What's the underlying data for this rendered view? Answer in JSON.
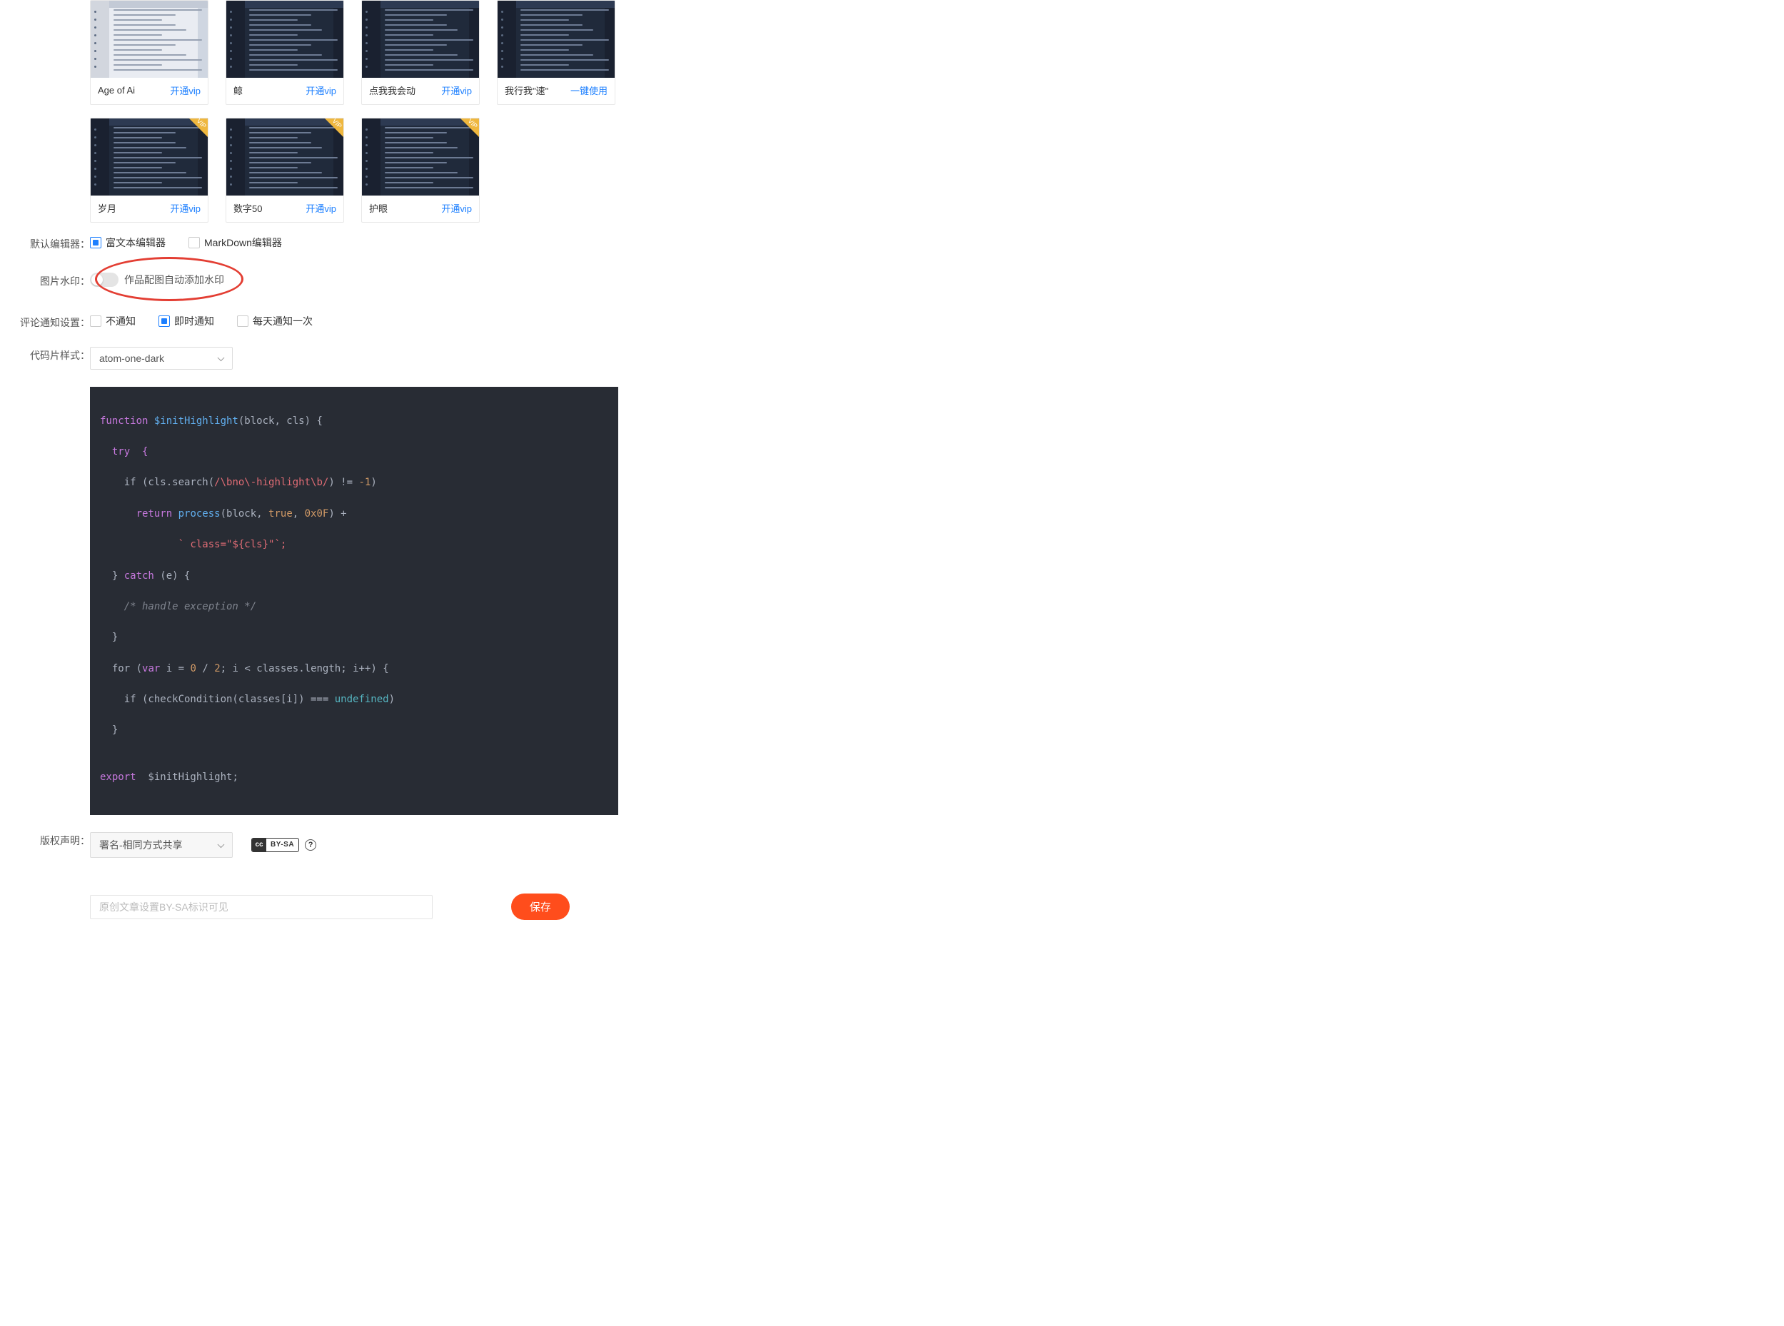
{
  "badges": {
    "vip": "VIP"
  },
  "themes_row1": [
    {
      "title": "Age of Ai",
      "action": "开通vip",
      "light": true,
      "vip": false
    },
    {
      "title": "鲸",
      "action": "开通vip",
      "light": false,
      "vip": false
    },
    {
      "title": "点我我会动",
      "action": "开通vip",
      "light": false,
      "vip": false
    },
    {
      "title": "我行我\"速\"",
      "action": "一键使用",
      "light": false,
      "vip": false
    }
  ],
  "themes_row2": [
    {
      "title": "岁月",
      "action": "开通vip",
      "light": false,
      "vip": true
    },
    {
      "title": "数字50",
      "action": "开通vip",
      "light": false,
      "vip": true
    },
    {
      "title": "护眼",
      "action": "开通vip",
      "light": false,
      "vip": true
    }
  ],
  "default_editor": {
    "label": "默认编辑器：",
    "opt1": "富文本编辑器",
    "opt2": "MarkDown编辑器",
    "selected": 0
  },
  "watermark": {
    "label": "图片水印：",
    "hint": "作品配图自动添加水印",
    "on": false
  },
  "comment_notify": {
    "label": "评论通知设置：",
    "opt1": "不通知",
    "opt2": "即时通知",
    "opt3": "每天通知一次",
    "selected": 1
  },
  "code_style": {
    "label": "代码片样式：",
    "value": "atom-one-dark"
  },
  "code_sample": {
    "fn_kw": "function ",
    "fn_name": "$initHighlight",
    "fn_args": "(block, cls) {",
    "try": "  try  {",
    "if1_a": "    if (cls.search(",
    "if1_re": "/\\bno\\-highlight\\b/",
    "if1_b": ") != ",
    "if1_neg1": "-1",
    "if1_c": ")",
    "ret_a": "      return",
    "ret_fn": " process",
    "ret_args_a": "(block, ",
    "ret_true": "true",
    "ret_args_b": ", ",
    "ret_hex": "0x0F",
    "ret_args_c": ") +",
    "tpl_a": "             ` class=\"",
    "tpl_sub": "${cls}",
    "tpl_b": "\"`;",
    "close_try": "  } ",
    "catch_kw": "catch",
    "catch_args": " (e) {",
    "cmt": "    /* handle exception */",
    "close_catch": "  }",
    "for_a": "  for (",
    "for_var": "var",
    "for_b": " i = ",
    "for_0": "0",
    "for_div": " / ",
    "for_2": "2",
    "for_c": "; i < classes.length; i++) {",
    "if2_a": "    if (checkCondition(classes[i]) === ",
    "if2_undef": "undefined",
    "if2_b": ")",
    "close_for": "  }",
    "blank": "",
    "export_kw": "export",
    "export_b": "  $initHighlight;"
  },
  "license": {
    "label": "版权声明：",
    "value": "署名-相同方式共享",
    "cc_left": "cc",
    "cc_right": "BY-SA",
    "help": "?",
    "placeholder": "原创文章设置BY-SA标识可见"
  },
  "save": "保存"
}
